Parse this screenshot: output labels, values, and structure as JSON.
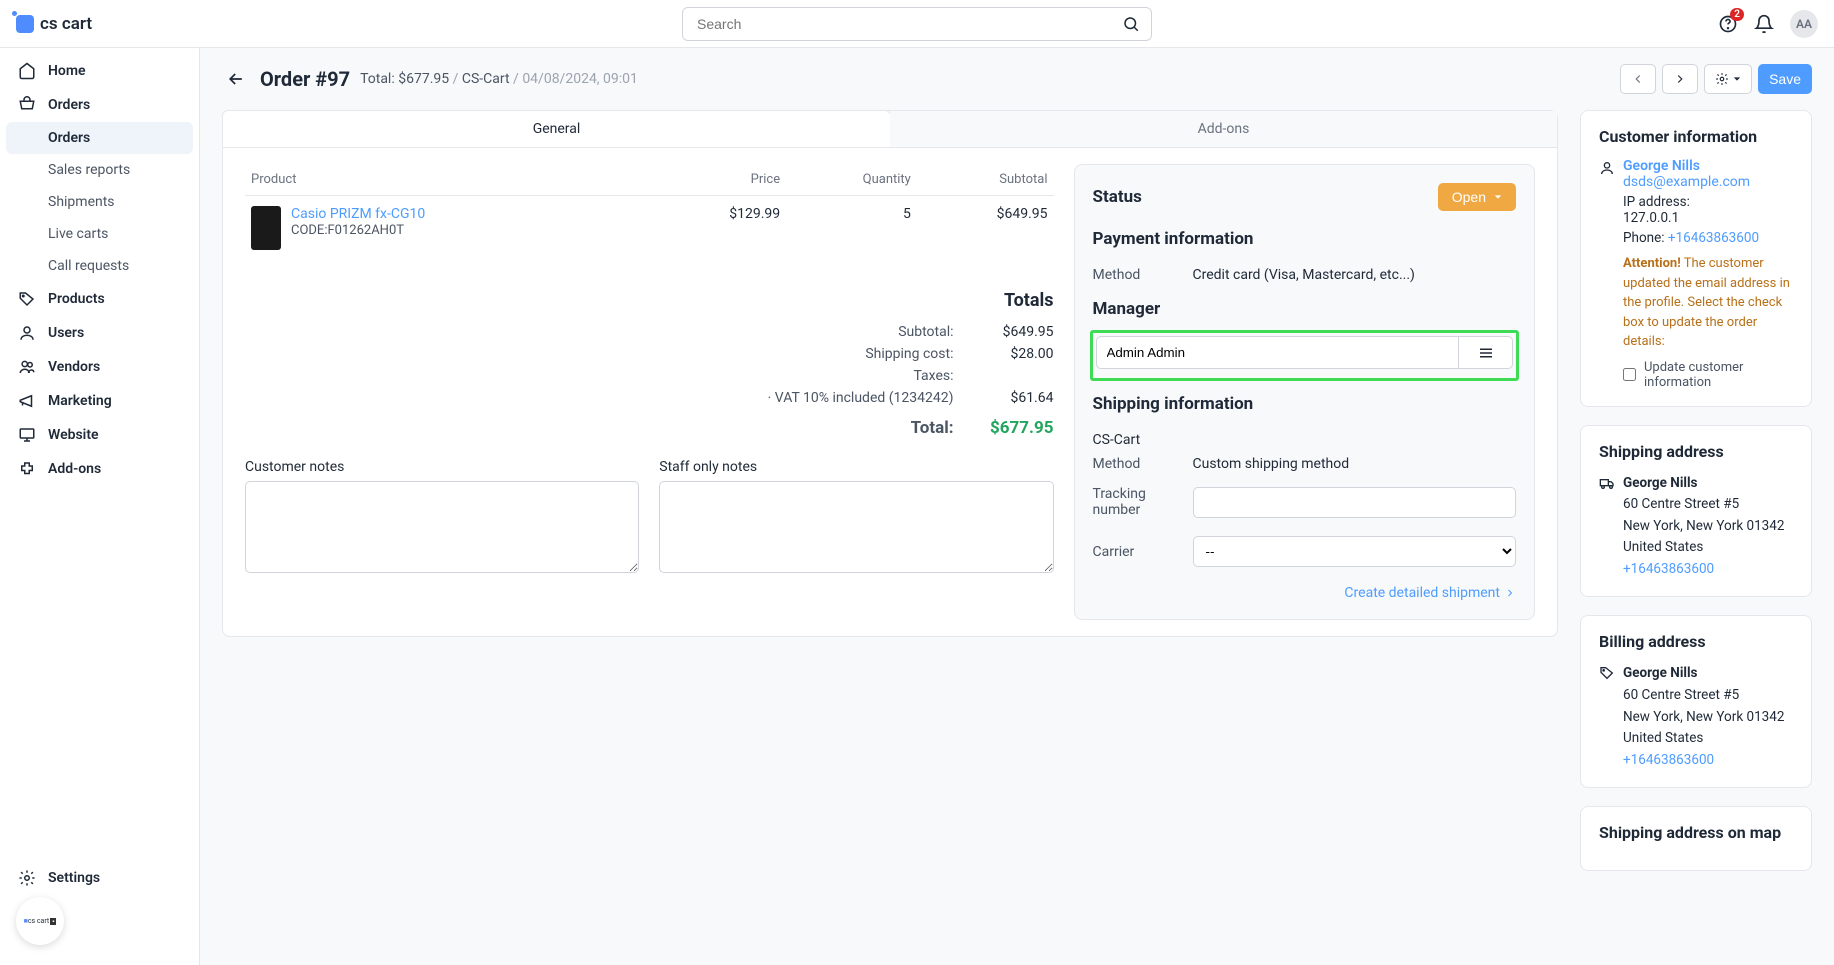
{
  "brand": "cs cart",
  "search_placeholder": "Search",
  "notif_badge": "2",
  "avatar": "AA",
  "sidebar": {
    "home": "Home",
    "orders": "Orders",
    "sub_orders": "Orders",
    "sales_reports": "Sales reports",
    "shipments": "Shipments",
    "live_carts": "Live carts",
    "call_requests": "Call requests",
    "products": "Products",
    "users": "Users",
    "vendors": "Vendors",
    "marketing": "Marketing",
    "website": "Website",
    "addons": "Add-ons",
    "settings": "Settings"
  },
  "header": {
    "title": "Order #97",
    "total_label": "Total:",
    "total_value": "$677.95",
    "source": "CS-Cart",
    "date": "04/08/2024, 09:01",
    "save": "Save"
  },
  "tabs": {
    "general": "General",
    "addons": "Add-ons"
  },
  "table": {
    "cols": {
      "product": "Product",
      "price": "Price",
      "quantity": "Quantity",
      "subtotal": "Subtotal"
    },
    "rows": [
      {
        "name": "Casio PRIZM fx-CG10",
        "code": "CODE:F01262AH0T",
        "price": "$129.99",
        "qty": "5",
        "subtotal": "$649.95"
      }
    ]
  },
  "totals": {
    "heading": "Totals",
    "subtotal_lbl": "Subtotal:",
    "subtotal": "$649.95",
    "shipping_lbl": "Shipping cost:",
    "shipping": "$28.00",
    "taxes_lbl": "Taxes:",
    "vat_lbl": "· VAT 10% included (1234242)",
    "vat": "$61.64",
    "grand_lbl": "Total:",
    "grand": "$677.95"
  },
  "notes": {
    "customer_lbl": "Customer notes",
    "staff_lbl": "Staff only notes"
  },
  "panel": {
    "status_lbl": "Status",
    "status_value": "Open",
    "payment_heading": "Payment information",
    "method_lbl": "Method",
    "payment_method": "Credit card (Visa, Mastercard, etc...)",
    "manager_heading": "Manager",
    "manager": "Admin Admin",
    "shipping_heading": "Shipping information",
    "shipping_source": "CS-Cart",
    "shipping_method": "Custom shipping method",
    "tracking_lbl": "Tracking number",
    "carrier_lbl": "Carrier",
    "carrier_default": "--",
    "create_shipment": "Create detailed shipment"
  },
  "customer": {
    "heading": "Customer information",
    "name": "George Nills",
    "email": "dsds@example.com",
    "ip_lbl": "IP address:",
    "ip": "127.0.0.1",
    "phone_lbl": "Phone:",
    "phone": "+16463863600",
    "warn_bold": "Attention!",
    "warn_text": "The customer updated the email address in the profile. Select the check box to update the order details:",
    "update_lbl": "Update customer information"
  },
  "shipping_addr": {
    "heading": "Shipping address",
    "name": "George Nills",
    "line1": "60 Centre Street #5",
    "line2": "New York, New York 01342",
    "line3": "United States",
    "phone": "+16463863600"
  },
  "billing_addr": {
    "heading": "Billing address",
    "name": "George Nills",
    "line1": "60 Centre Street #5",
    "line2": "New York, New York 01342",
    "line3": "United States",
    "phone": "+16463863600"
  },
  "map_heading": "Shipping address on map"
}
